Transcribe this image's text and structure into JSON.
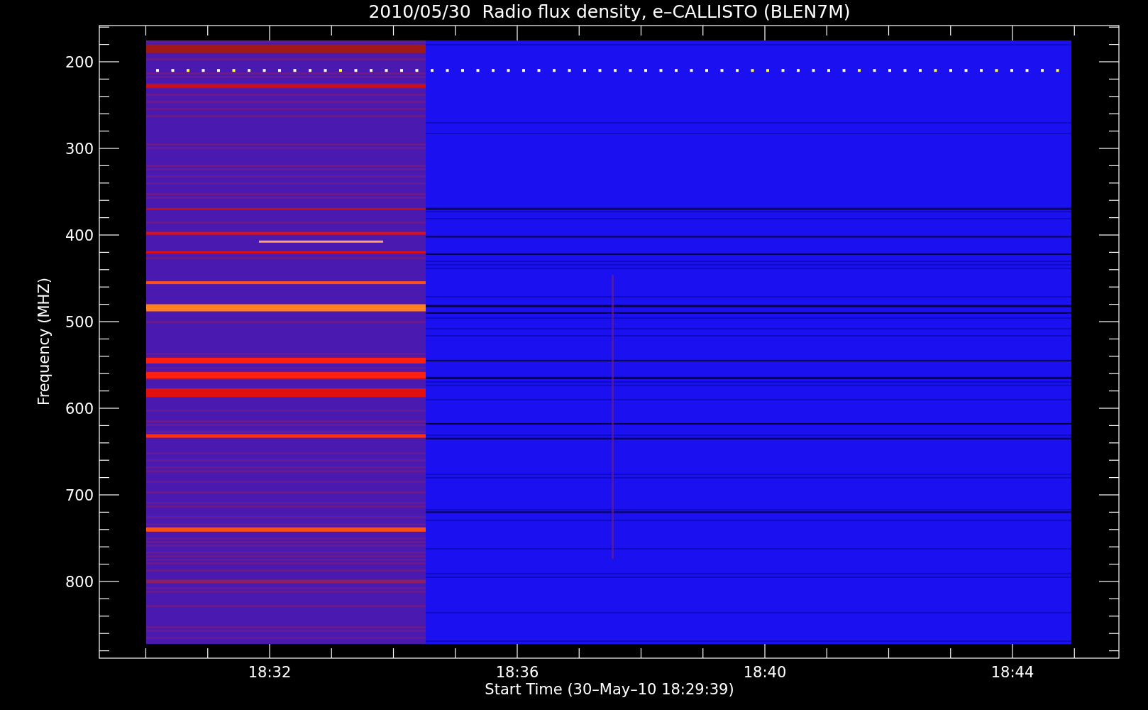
{
  "title": "2010/05/30  Radio flux density, e–CALLISTO (BLEN7M)",
  "y_axis": {
    "label": "Frequency (MHZ)",
    "ticks": [
      "200",
      "300",
      "400",
      "500",
      "600",
      "700",
      "800"
    ]
  },
  "x_axis": {
    "label": "Start Time (30–May–10 18:29:39)",
    "ticks": [
      "18:32",
      "18:36",
      "18:40",
      "18:44"
    ]
  }
}
